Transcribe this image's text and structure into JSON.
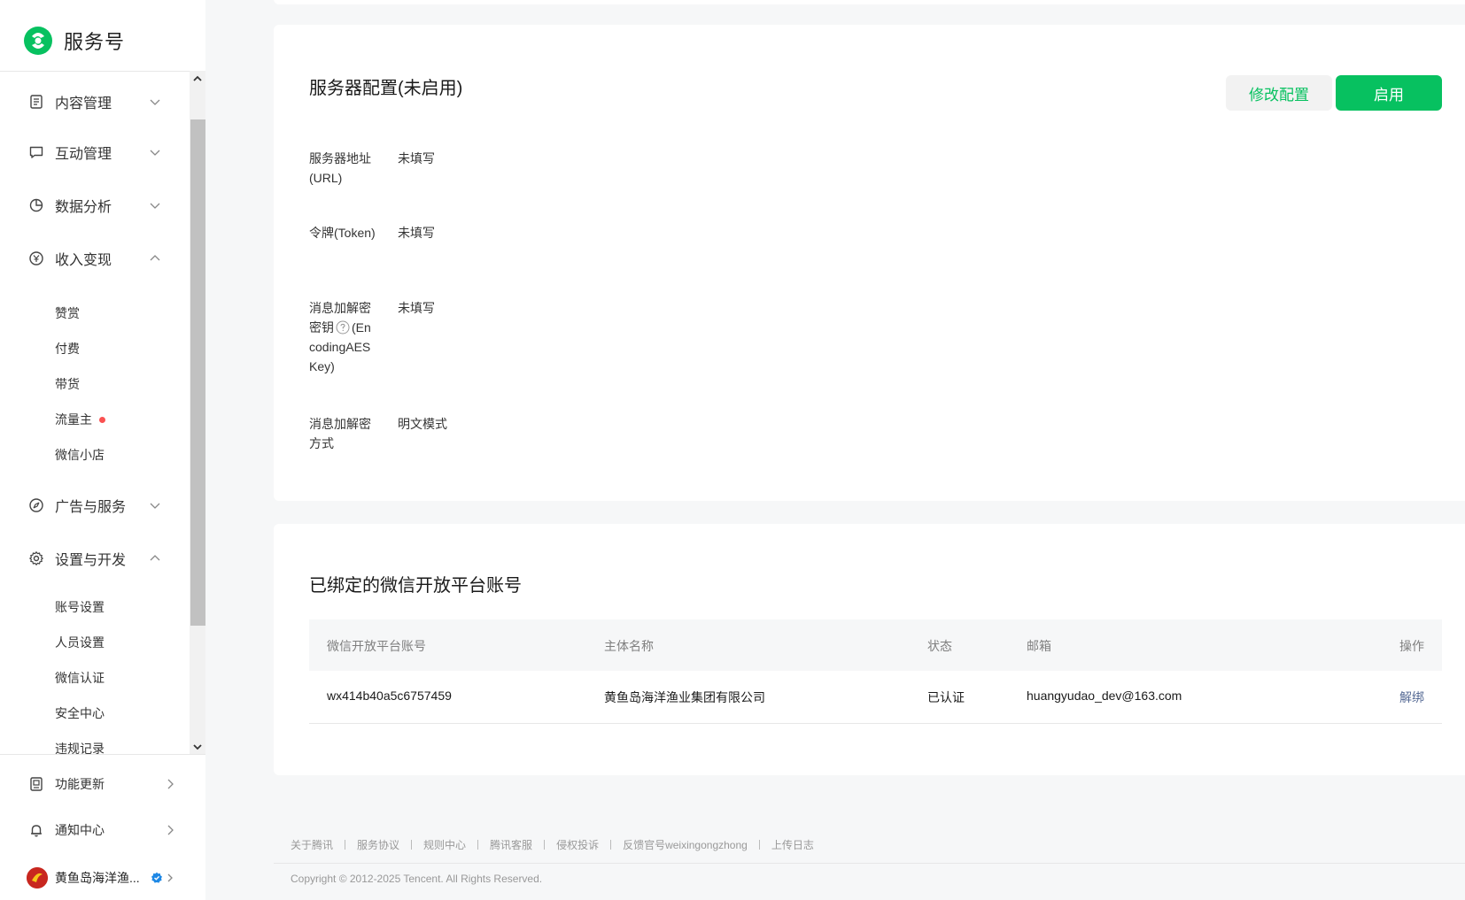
{
  "brand": {
    "name": "服务号"
  },
  "sidebar": {
    "groups": [
      {
        "label": "内容管理",
        "icon": "document-icon",
        "expanded": false
      },
      {
        "label": "互动管理",
        "icon": "chat-icon",
        "expanded": false
      },
      {
        "label": "数据分析",
        "icon": "pie-chart-icon",
        "expanded": false
      },
      {
        "label": "收入变现",
        "icon": "yen-icon",
        "expanded": true,
        "items": [
          "赞赏",
          "付费",
          "带货",
          "流量主",
          "微信小店"
        ]
      },
      {
        "label": "广告与服务",
        "icon": "compass-icon",
        "expanded": false
      },
      {
        "label": "设置与开发",
        "icon": "gear-icon",
        "expanded": true,
        "items": [
          "账号设置",
          "人员设置",
          "微信认证",
          "安全中心",
          "违规记录"
        ]
      }
    ],
    "bottom": [
      {
        "label": "功能更新",
        "icon": "update-icon"
      },
      {
        "label": "通知中心",
        "icon": "bell-icon"
      }
    ],
    "account": {
      "name": "黄鱼岛海洋渔..."
    }
  },
  "server_config": {
    "title": "服务器配置(未启用)",
    "modify_label": "修改配置",
    "enable_label": "启用",
    "fields": [
      {
        "label": "服务器地址(URL)",
        "value": "未填写"
      },
      {
        "label": "令牌(Token)",
        "value": "未填写"
      },
      {
        "label_before": "消息加解密密钥",
        "label_after": "(EncodingAESKey)",
        "value": "未填写"
      },
      {
        "label": "消息加解密方式",
        "value": "明文模式"
      }
    ]
  },
  "bound_accounts": {
    "title": "已绑定的微信开放平台账号",
    "columns": [
      "微信开放平台账号",
      "主体名称",
      "状态",
      "邮箱",
      "操作"
    ],
    "rows": [
      {
        "account": "wx414b40a5c6757459",
        "entity": "黄鱼岛海洋渔业集团有限公司",
        "status": "已认证",
        "email": "huangyudao_dev@163.com",
        "action": "解绑"
      }
    ]
  },
  "footer": {
    "links": [
      "关于腾讯",
      "服务协议",
      "规则中心",
      "腾讯客服",
      "侵权投诉",
      "反馈官号weixingongzhong",
      "上传日志"
    ],
    "copyright": "Copyright © 2012-2025 Tencent. All Rights Reserved."
  },
  "colors": {
    "accent": "#07c160",
    "link": "#576b95",
    "badge": "#fa5151"
  }
}
